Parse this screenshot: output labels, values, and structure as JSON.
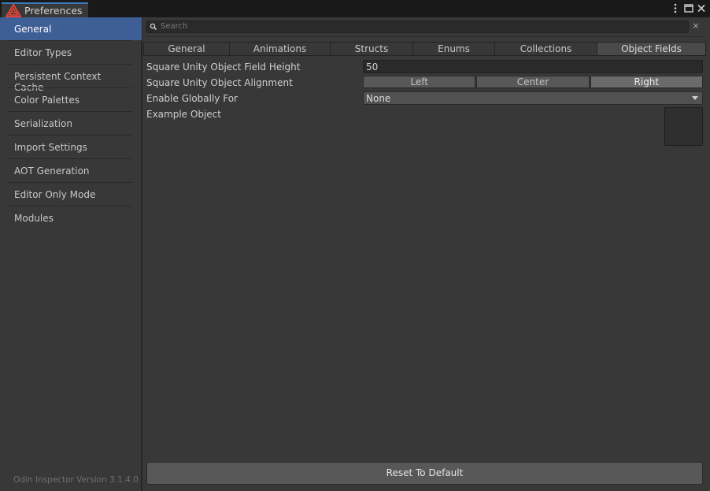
{
  "window": {
    "title": "Preferences",
    "menu_icon": "kebab-menu-icon",
    "maximize_icon": "maximize-icon",
    "close_icon": "close-icon"
  },
  "sidebar": {
    "items": [
      {
        "label": "General",
        "active": true
      },
      {
        "label": "Editor Types",
        "active": false
      },
      {
        "label": "Persistent Context Cache",
        "active": false
      },
      {
        "label": "Color Palettes",
        "active": false
      },
      {
        "label": "Serialization",
        "active": false
      },
      {
        "label": "Import Settings",
        "active": false
      },
      {
        "label": "AOT Generation",
        "active": false
      },
      {
        "label": "Editor Only Mode",
        "active": false
      },
      {
        "label": "Modules",
        "active": false
      }
    ],
    "version": "Odin Inspector Version 3.1.4.0"
  },
  "search": {
    "placeholder": "Search",
    "clear": "×"
  },
  "tabs": [
    {
      "label": "General",
      "selected": false
    },
    {
      "label": "Animations",
      "selected": false
    },
    {
      "label": "Structs",
      "selected": false
    },
    {
      "label": "Enums",
      "selected": false
    },
    {
      "label": "Collections",
      "selected": false
    },
    {
      "label": "Object Fields",
      "selected": true
    }
  ],
  "settings": {
    "field_height_label": "Square Unity Object Field Height",
    "field_height_value": "50",
    "alignment_label": "Square Unity Object Alignment",
    "alignment_options": [
      "Left",
      "Center",
      "Right"
    ],
    "alignment_selected": "Right",
    "enable_globally_label": "Enable Globally For",
    "enable_globally_value": "None",
    "example_object_label": "Example Object"
  },
  "reset_button": "Reset To Default",
  "colors": {
    "accent": "#3e5f96",
    "tab_accent": "#3a79bb",
    "logo": "#e0453a"
  }
}
